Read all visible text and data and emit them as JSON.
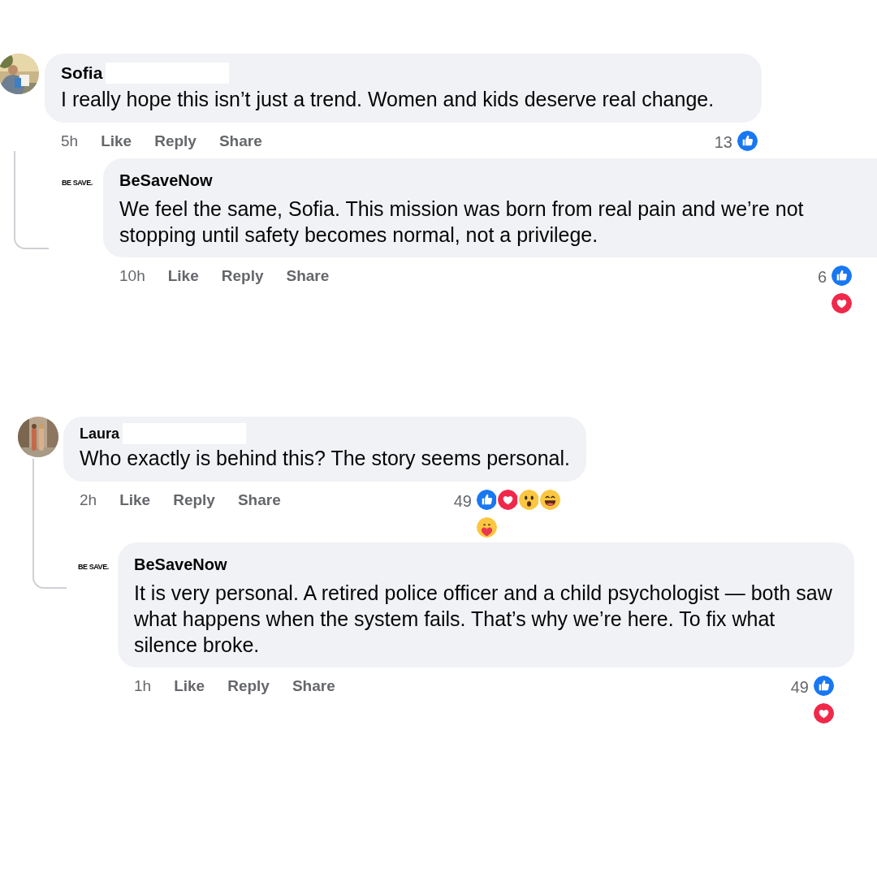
{
  "threads": [
    {
      "comment": {
        "author": "Sofia",
        "redacted": true,
        "text": "I really hope this isn’t just a trend. Women and kids deserve real change.",
        "time": "5h",
        "actions": [
          "Like",
          "Reply",
          "Share"
        ],
        "reactions": {
          "count": "13",
          "rows": [
            [
              {
                "kind": "like"
              }
            ]
          ]
        }
      },
      "reply": {
        "logo_text": "BE SAVE.",
        "author": "BeSaveNow",
        "text": "We feel the same, Sofia. This mission was born from real pain and we’re not stopping until safety becomes normal, not a privilege.",
        "time": "10h",
        "actions": [
          "Like",
          "Reply",
          "Share"
        ],
        "reactions": {
          "count": "6",
          "rows": [
            [
              {
                "kind": "like"
              }
            ],
            [
              {
                "kind": "love"
              }
            ]
          ]
        }
      }
    },
    {
      "comment": {
        "author": "Laura",
        "redacted": true,
        "text": "Who exactly is behind this? The story seems personal.",
        "time": "2h",
        "actions": [
          "Like",
          "Reply",
          "Share"
        ],
        "reactions": {
          "count": "49",
          "rows": [
            [
              {
                "kind": "like"
              },
              {
                "kind": "love"
              },
              {
                "kind": "wow"
              },
              {
                "kind": "haha"
              }
            ],
            [
              {
                "kind": "care"
              }
            ]
          ]
        }
      },
      "reply": {
        "logo_text": "BE SAVE.",
        "author": "BeSaveNow",
        "text": "It is very personal. A retired police officer and a child psychologist — both saw what happens when the system fails. That’s why we’re here. To fix what silence broke.",
        "time": "1h",
        "actions": [
          "Like",
          "Reply",
          "Share"
        ],
        "reactions": {
          "count": "49",
          "rows": [
            [
              {
                "kind": "like"
              }
            ],
            [
              {
                "kind": "love"
              }
            ]
          ]
        }
      }
    }
  ]
}
